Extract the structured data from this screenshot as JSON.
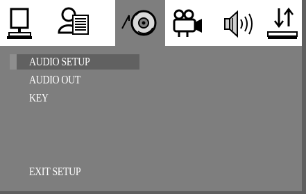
{
  "menu": {
    "tabs": [
      {
        "icon": "monitor-icon",
        "active": false
      },
      {
        "icon": "user-document-icon",
        "active": false
      },
      {
        "icon": "audio-disc-icon",
        "active": true
      },
      {
        "icon": "projector-camera-icon",
        "active": false
      },
      {
        "icon": "speaker-icon",
        "active": false
      },
      {
        "icon": "sort-arrows-icon",
        "active": false
      }
    ],
    "items": [
      {
        "label": "AUDIO SETUP",
        "selected": true
      },
      {
        "label": "AUDIO OUT",
        "selected": false
      },
      {
        "label": "KEY",
        "selected": false
      }
    ],
    "exit_label": "EXIT SETUP"
  },
  "colors": {
    "background": "#7e7e7e",
    "tabbar": "#ffffff",
    "highlight": "#616161",
    "text": "#ffffff"
  }
}
